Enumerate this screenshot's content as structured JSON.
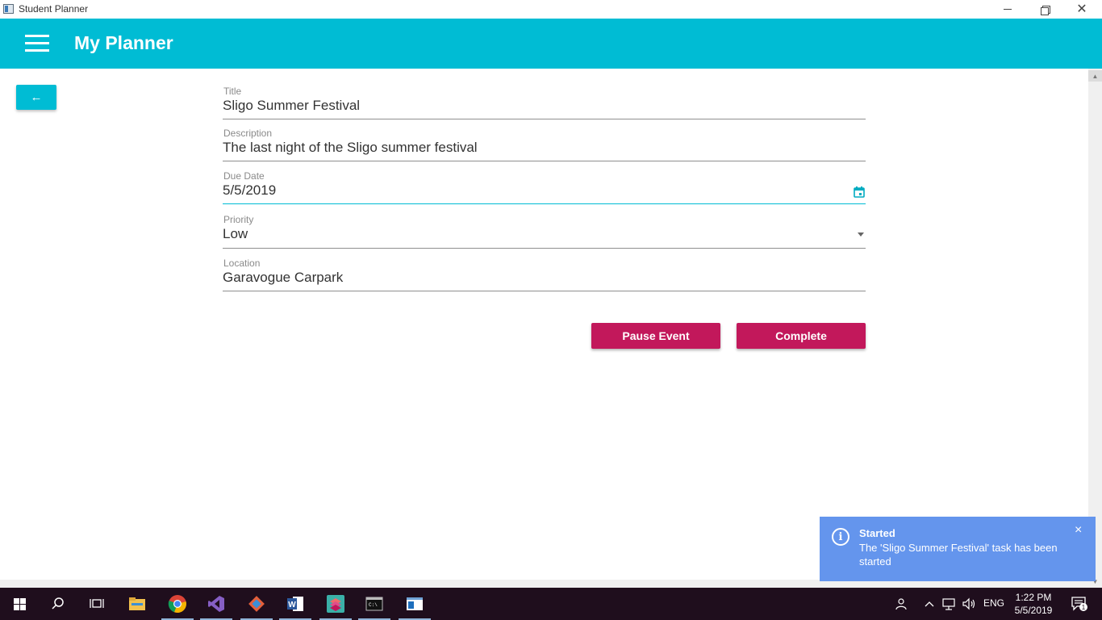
{
  "window": {
    "title": "Student Planner",
    "min_icon": "minimize-icon",
    "max_icon": "restore-icon",
    "close_icon": "close-icon"
  },
  "appbar": {
    "title": "My Planner",
    "menu_icon": "hamburger-menu-icon",
    "color": "#00bcd4"
  },
  "back_button": {
    "label": "←",
    "icon": "arrow-left-icon"
  },
  "form": {
    "title": {
      "label": "Title",
      "value": "Sligo Summer Festival"
    },
    "description": {
      "label": "Description",
      "value": "The last night of the Sligo summer festival"
    },
    "due_date": {
      "label": "Due Date",
      "value": "5/5/2019",
      "icon": "calendar-icon"
    },
    "priority": {
      "label": "Priority",
      "value": "Low",
      "icon": "dropdown-arrow-icon"
    },
    "location": {
      "label": "Location",
      "value": "Garavogue Carpark"
    }
  },
  "actions": {
    "pause_label": "Pause Event",
    "complete_label": "Complete",
    "color": "#c2185b"
  },
  "toast": {
    "title": "Started",
    "message": "The 'Sligo Summer Festival' task has been started",
    "icon": "info-icon",
    "close": "×",
    "color": "#6495ed"
  },
  "taskbar": {
    "items": [
      "start-icon",
      "search-icon",
      "task-view-icon",
      "file-explorer-icon",
      "chrome-icon",
      "visual-studio-icon",
      "git-icon",
      "word-icon",
      "layers-app-icon",
      "terminal-icon",
      "student-planner-app-icon"
    ],
    "language": "ENG",
    "time": "1:22 PM",
    "date": "5/5/2019",
    "notification_count": "1"
  }
}
